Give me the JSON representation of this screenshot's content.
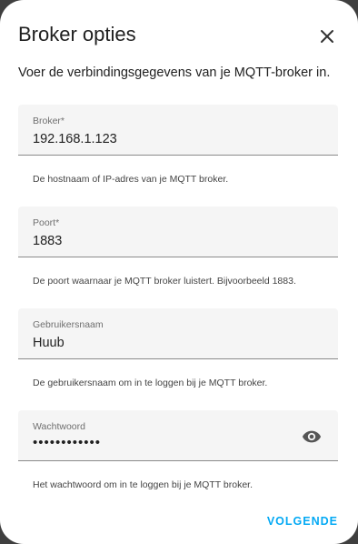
{
  "dialog": {
    "title": "Broker opties",
    "intro": "Voer de verbindingsgegevens van je MQTT-broker in.",
    "fields": [
      {
        "label": "Broker*",
        "value": "192.168.1.123",
        "helper": "De hostnaam of IP-adres van je MQTT broker."
      },
      {
        "label": "Poort*",
        "value": "1883",
        "helper": "De poort waarnaar je MQTT broker luistert. Bijvoorbeeld 1883."
      },
      {
        "label": "Gebruikersnaam",
        "value": "Huub",
        "helper": "De gebruikersnaam om in te loggen bij je MQTT broker."
      },
      {
        "label": "Wachtwoord",
        "value": "••••••••••••",
        "helper": "Het wachtwoord om in te loggen bij je MQTT broker."
      }
    ],
    "next_label": "VOLGENDE"
  },
  "icons": {
    "close": "close-icon",
    "visibility": "eye-icon"
  },
  "colors": {
    "accent": "#03a9f4",
    "field_bg": "#f5f5f5"
  }
}
